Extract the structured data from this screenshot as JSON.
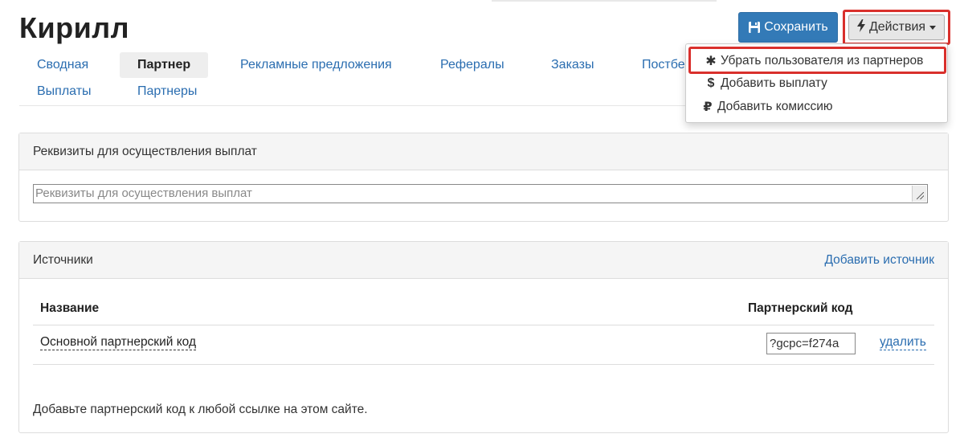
{
  "page": {
    "title": "Кирилл"
  },
  "toolbar": {
    "save_label": "Сохранить",
    "actions_label": "Действия"
  },
  "tabs": [
    {
      "label": "Сводная",
      "active": false
    },
    {
      "label": "Партнер",
      "active": true
    },
    {
      "label": "Рекламные предложения",
      "active": false
    },
    {
      "label": "Рефералы",
      "active": false
    },
    {
      "label": "Заказы",
      "active": false
    },
    {
      "label": "Постбе",
      "active": false
    },
    {
      "label": "Выплаты",
      "active": false
    },
    {
      "label": "Партнеры",
      "active": false
    }
  ],
  "actions_menu": {
    "items": [
      {
        "label": "Убрать пользователя из партнеров",
        "icon": "asterisk-icon",
        "glyph": "✱",
        "highlighted": true
      },
      {
        "label": "Добавить выплату",
        "icon": "dollar-icon",
        "glyph": "$",
        "highlighted": false
      },
      {
        "label": "Добавить комиссию",
        "icon": "ruble-icon",
        "glyph": "₽",
        "highlighted": false
      }
    ]
  },
  "payout_panel": {
    "title": "Реквизиты для осуществления выплат",
    "textarea_placeholder": "Реквизиты для осуществления выплат"
  },
  "sources_panel": {
    "title": "Источники",
    "add_link": "Добавить источник",
    "columns": [
      "Название",
      "Партнерский код"
    ],
    "rows": [
      {
        "name": "Основной партнерский код",
        "code": "?gcpc=f274a",
        "delete_label": "удалить"
      }
    ],
    "footnote": "Добавьте партнерский код к любой ссылке на этом сайте."
  },
  "colors": {
    "primary": "#337ab7",
    "link": "#2a6db0",
    "highlight": "#d9302c"
  }
}
